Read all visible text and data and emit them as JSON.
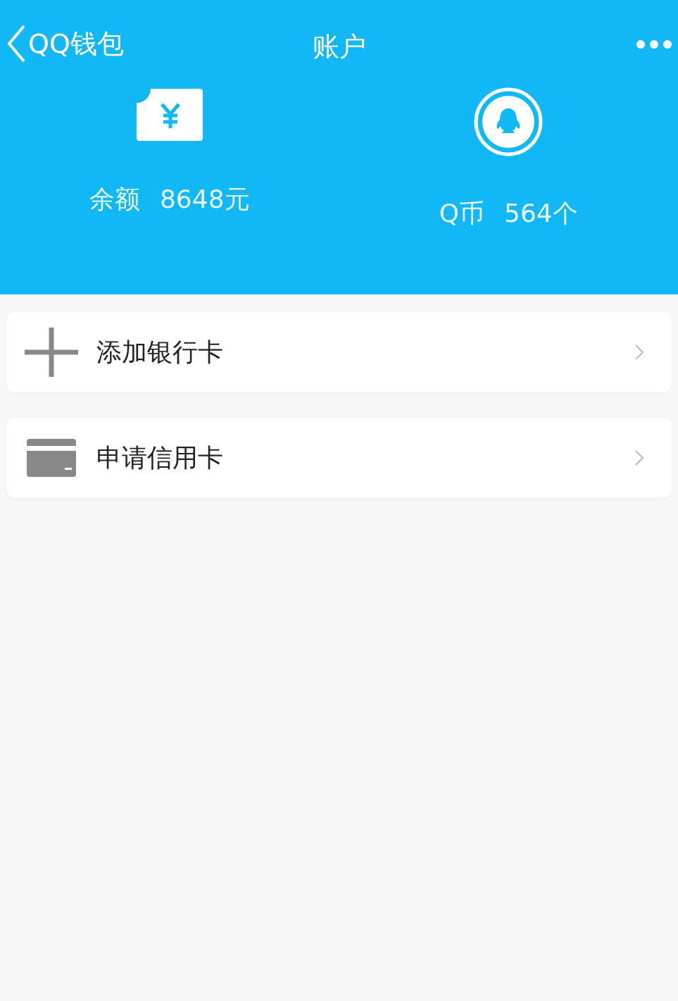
{
  "nav": {
    "back_label": "QQ钱包",
    "title": "账户"
  },
  "assets": [
    {
      "kind": "balance",
      "label": "余额",
      "value": "8648元"
    },
    {
      "kind": "coins",
      "label": "Q币",
      "value": "564个"
    }
  ],
  "actions": [
    {
      "kind": "add",
      "label": "添加银行卡"
    },
    {
      "kind": "card",
      "label": "申请信用卡"
    }
  ]
}
